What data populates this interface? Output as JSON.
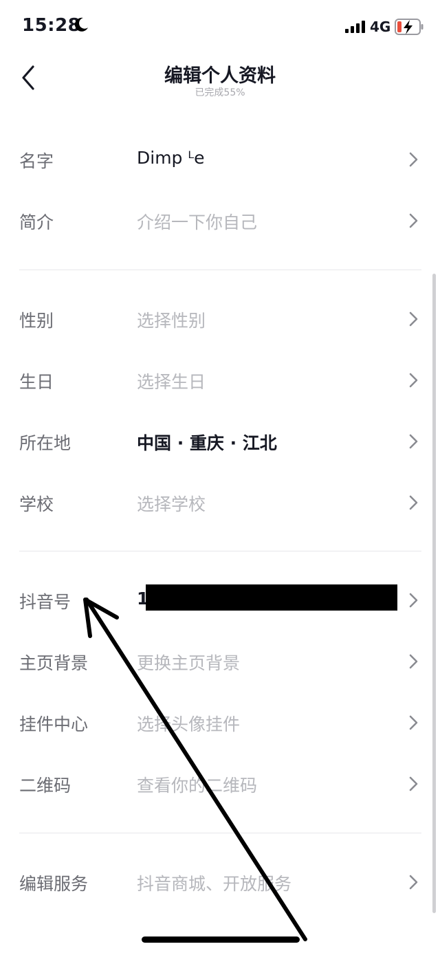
{
  "status_bar": {
    "time": "15:28",
    "network": "4G"
  },
  "header": {
    "title": "编辑个人资料",
    "subtitle": "已完成55%"
  },
  "rows": [
    {
      "label": "名字",
      "value": "Dimp ᴸe"
    },
    {
      "label": "简介",
      "value": "介绍一下你自己"
    },
    {
      "label": "性别",
      "value": "选择性别"
    },
    {
      "label": "生日",
      "value": "选择生日"
    },
    {
      "label": "所在地",
      "value": "中国 · 重庆 · 江北"
    },
    {
      "label": "学校",
      "value": "选择学校"
    },
    {
      "label": "抖音号",
      "value": "1"
    },
    {
      "label": "主页背景",
      "value": "更换主页背景"
    },
    {
      "label": "挂件中心",
      "value": "选择头像挂件"
    },
    {
      "label": "二维码",
      "value": "查看你的二维码"
    },
    {
      "label": "编辑服务",
      "value": "抖音商城、开放服务"
    }
  ],
  "icons": {
    "back": "chevron-left-icon",
    "row_action": "chevron-right-icon",
    "moon": "moon-icon",
    "signal": "signal-icon",
    "battery": "battery-charging-icon"
  },
  "colors": {
    "label": "#6b6c73",
    "placeholder": "#b6b7bc",
    "text": "#161823",
    "battery_low": "#e94e3c"
  }
}
